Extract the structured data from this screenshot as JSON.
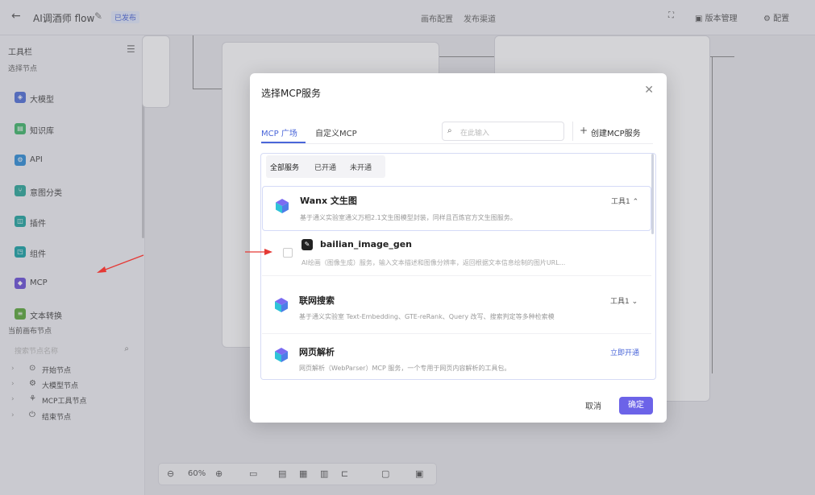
{
  "header": {
    "back_icon": "arrow-left-icon",
    "title": "AI调酒师 flow",
    "status_badge": "已发布",
    "tabs": [
      "画布配置",
      "发布渠道"
    ],
    "version_label": "版本管理",
    "settings_label": "配置"
  },
  "sidebar": {
    "title": "工具栏",
    "section_nodes": "选择节点",
    "items": [
      {
        "label": "大模型",
        "color": "#4f6fd8",
        "icon": "brain-icon"
      },
      {
        "label": "知识库",
        "color": "#3fb86a",
        "icon": "book-icon"
      },
      {
        "label": "API",
        "color": "#2f8ed8",
        "icon": "api-icon"
      },
      {
        "label": "意图分类",
        "color": "#2aa89a",
        "icon": "branch-icon"
      },
      {
        "label": "插件",
        "color": "#1fa5a0",
        "icon": "plugin-icon"
      },
      {
        "label": "组件",
        "color": "#17a2a6",
        "icon": "component-icon"
      },
      {
        "label": "MCP",
        "color": "#6a4fd8",
        "icon": "mcp-icon"
      },
      {
        "label": "文本转换",
        "color": "#5aa83a",
        "icon": "text-transform-icon"
      }
    ],
    "section_current": "当前画布节点",
    "search_placeholder": "搜索节点名称",
    "tree": [
      {
        "label": "开始节点"
      },
      {
        "label": "大模型节点"
      },
      {
        "label": "MCP工具节点"
      },
      {
        "label": "结束节点"
      }
    ]
  },
  "canvas": {
    "zoom": "60%"
  },
  "modal": {
    "title": "选择MCP服务",
    "tabs": [
      "MCP 广场",
      "自定义MCP"
    ],
    "search_placeholder": "在此输入",
    "create_label": "创建MCP服务",
    "filters": [
      "全部服务",
      "已开通",
      "未开通"
    ],
    "services": [
      {
        "name": "Wanx 文生图",
        "desc": "基于通义实验室通义万相2.1文生图模型封装，同样且百炼官方文生图服务。",
        "tools": "工具1"
      },
      {
        "name": "联网搜索",
        "desc": "基于通义实验室 Text-Embedding、GTE-reRank、Query 改写、搜索判定等多种检索模",
        "tools": "工具1"
      },
      {
        "name": "网页解析",
        "desc": "网页解析（WebParser）MCP 服务，一个专用于网页内容解析的工具包。",
        "action": "立即开通"
      }
    ],
    "tool": {
      "name": "bailian_image_gen",
      "desc": "AI绘画（图像生成）服务，输入文本描述和图像分辨率，返回根据文本信息绘制的图片URL..."
    },
    "cancel_label": "取消",
    "ok_label": "确定"
  },
  "colors": {
    "accent": "#4a66d9",
    "primary_button": "#6c63e8",
    "annotation_arrow": "#e53935"
  }
}
